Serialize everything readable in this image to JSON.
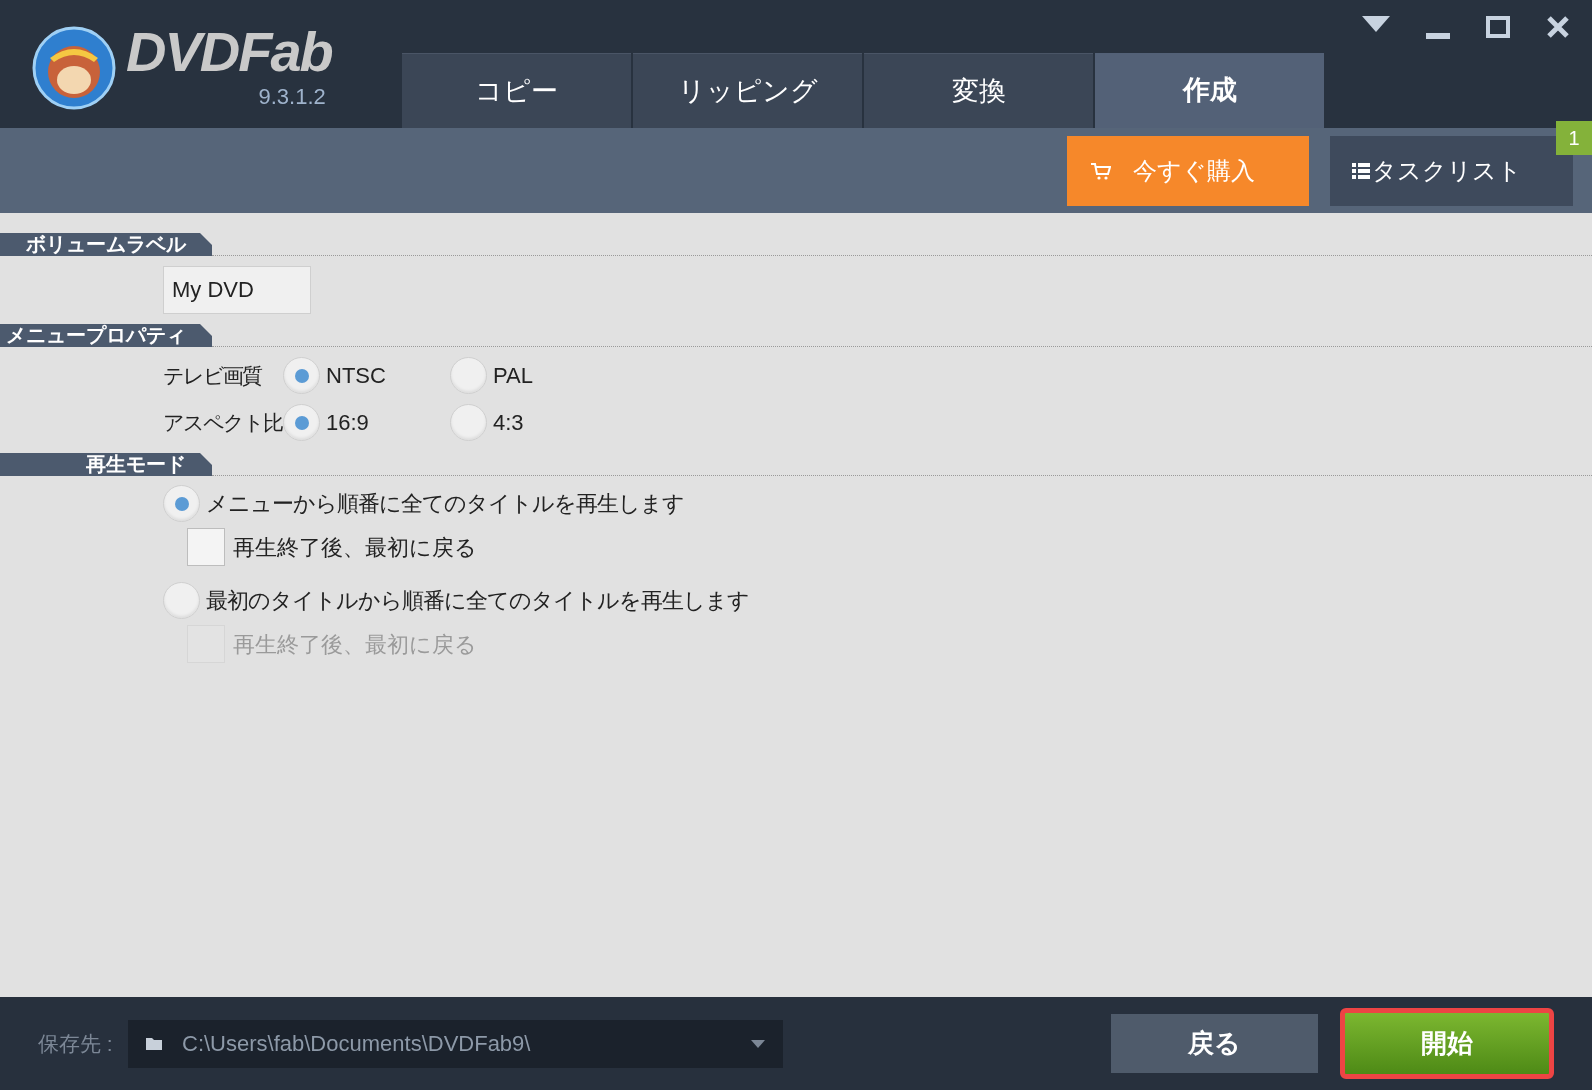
{
  "app": {
    "name": "DVDFab",
    "version": "9.3.1.2"
  },
  "tabs": [
    {
      "label": "コピー",
      "selected": false
    },
    {
      "label": "リッピング",
      "selected": false
    },
    {
      "label": "変換",
      "selected": false
    },
    {
      "label": "作成",
      "selected": true
    }
  ],
  "toolbar": {
    "buy_button": "今すぐ購入",
    "task_list": {
      "label": "タスクリスト",
      "badge": "1"
    }
  },
  "sections": [
    {
      "title": "ボリュームラベル",
      "kind": "text",
      "value": "My DVD"
    },
    {
      "title": "メニュープロパティ",
      "kind": "radio_groups",
      "groups": [
        {
          "label": "テレビ画質",
          "options": [
            {
              "label": "NTSC",
              "selected": true
            },
            {
              "label": "PAL",
              "selected": false
            }
          ]
        },
        {
          "label": "アスペクト比",
          "options": [
            {
              "label": "16:9",
              "selected": true
            },
            {
              "label": "4:3",
              "selected": false
            }
          ]
        }
      ]
    },
    {
      "title": "再生モード",
      "kind": "play_modes",
      "options": [
        {
          "label": "メニューから順番に全てのタイトルを再生します",
          "selected": true,
          "checkbox": {
            "label": "再生終了後、最初に戻る",
            "checked": false,
            "disabled": false
          }
        },
        {
          "label": "最初のタイトルから順番に全てのタイトルを再生します",
          "selected": false,
          "checkbox": {
            "label": "再生終了後、最初に戻る",
            "checked": false,
            "disabled": true
          }
        }
      ]
    }
  ],
  "footer": {
    "save_label": "保存先 :",
    "path": "C:\\Users\\fab\\Documents\\DVDFab9\\",
    "back_button": "戻る",
    "start_button": {
      "label": "開始",
      "highlighted": true
    }
  }
}
